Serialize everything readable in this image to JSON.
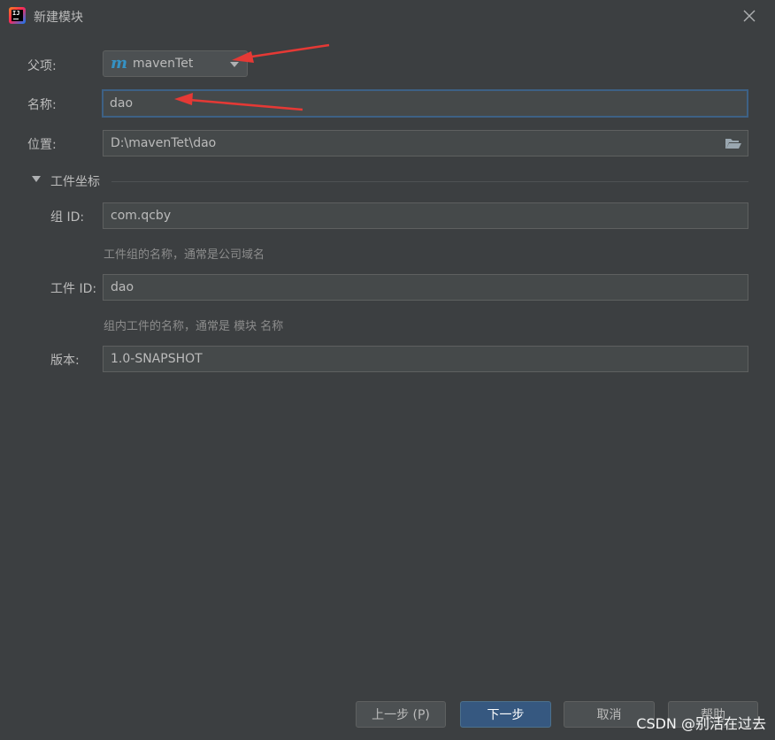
{
  "window": {
    "title": "新建模块",
    "close_icon": "close-icon",
    "app_icon": "intellij-idea-icon"
  },
  "parent": {
    "label": "父项:",
    "value": "mavenTet",
    "icon": "maven-module-icon"
  },
  "name": {
    "label": "名称:",
    "value": "dao"
  },
  "location": {
    "label": "位置:",
    "value": "D:\\mavenTet\\dao",
    "icon": "folder-open-icon"
  },
  "artifact_coords": {
    "section_title": "工件坐标",
    "group_id": {
      "label": "组 ID:",
      "value": "com.qcby",
      "hint": "工件组的名称，通常是公司域名"
    },
    "artifact_id": {
      "label": "工件 ID:",
      "value": "dao",
      "hint": "组内工件的名称，通常是 模块 名称"
    },
    "version": {
      "label": "版本:",
      "value": "1.0-SNAPSHOT"
    }
  },
  "buttons": {
    "previous": "上一步 (P)",
    "next": "下一步",
    "cancel": "取消",
    "help": "帮助"
  },
  "watermark": "CSDN @别活在过去",
  "colors": {
    "annotation_arrow": "#e53935",
    "accent": "#365880",
    "background": "#3c3f41"
  }
}
